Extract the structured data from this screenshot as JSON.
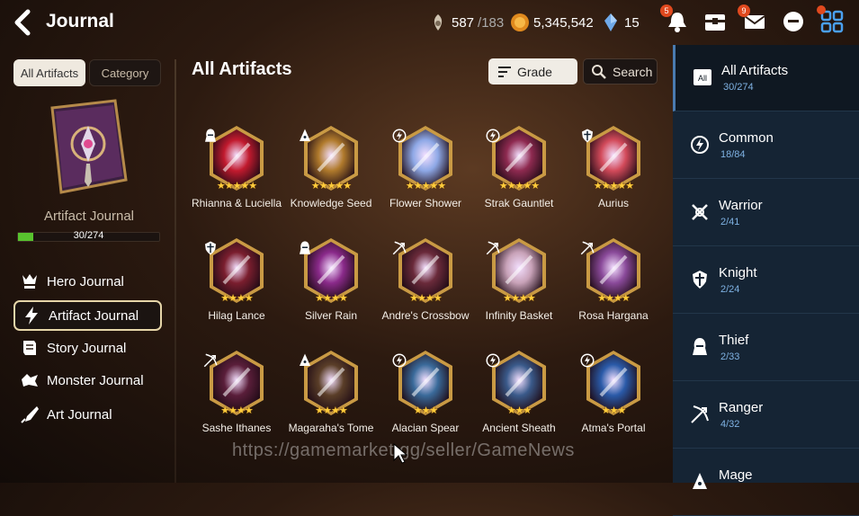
{
  "header": {
    "title": "Journal",
    "stamina": {
      "current": "587",
      "max": "/183"
    },
    "gold": "5,345,542",
    "crystal": "15",
    "badges": {
      "bell": "5",
      "mail": "9"
    }
  },
  "left_panel": {
    "tabs": [
      "All Artifacts",
      "Category"
    ],
    "book_label": "Artifact Journal",
    "progress_text": "30/274",
    "progress_fraction": 0.11,
    "menu": [
      {
        "label": "Hero Journal",
        "icon": "hero-icon"
      },
      {
        "label": "Artifact Journal",
        "icon": "lightning-icon"
      },
      {
        "label": "Story Journal",
        "icon": "story-icon"
      },
      {
        "label": "Monster Journal",
        "icon": "monster-icon"
      },
      {
        "label": "Art Journal",
        "icon": "art-icon"
      }
    ]
  },
  "main": {
    "title": "All Artifacts",
    "grade_label": "Grade",
    "search_label": "Search",
    "artifacts": [
      {
        "name": "Rhianna & Luciella",
        "stars": "★★★★★",
        "class": "thief",
        "color": "#c11a2e"
      },
      {
        "name": "Knowledge Seed",
        "stars": "★★★★★",
        "class": "mage",
        "color": "#b07a2c"
      },
      {
        "name": "Flower Shower",
        "stars": "★★★★★",
        "class": "common",
        "color": "#8ea8e6"
      },
      {
        "name": "Strak Gauntlet",
        "stars": "★★★★★",
        "class": "common",
        "color": "#8e2a50"
      },
      {
        "name": "Aurius",
        "stars": "★★★★★",
        "class": "knight",
        "color": "#d24a5a"
      },
      {
        "name": "Hilag Lance",
        "stars": "★★★★",
        "class": "knight",
        "color": "#7a1e2e"
      },
      {
        "name": "Silver Rain",
        "stars": "★★★★",
        "class": "thief",
        "color": "#8a2a8a"
      },
      {
        "name": "Andre's Crossbow",
        "stars": "★★★★",
        "class": "ranger",
        "color": "#6a2a3a"
      },
      {
        "name": "Infinity Basket",
        "stars": "★★★★",
        "class": "ranger",
        "color": "#c8a2b8"
      },
      {
        "name": "Rosa Hargana",
        "stars": "★★★★",
        "class": "ranger",
        "color": "#8a4a9a"
      },
      {
        "name": "Sashe Ithanes",
        "stars": "★★★★",
        "class": "ranger",
        "color": "#5a1e3a"
      },
      {
        "name": "Magaraha's Tome",
        "stars": "★★★★",
        "class": "mage",
        "color": "#5a3e28"
      },
      {
        "name": "Alacian Spear",
        "stars": "★★★",
        "class": "common",
        "color": "#3a6a9a"
      },
      {
        "name": "Ancient Sheath",
        "stars": "★★★",
        "class": "common",
        "color": "#3a5a8a"
      },
      {
        "name": "Atma's Portal",
        "stars": "★★★",
        "class": "common",
        "color": "#2a5aa8"
      }
    ]
  },
  "right_panel": {
    "categories": [
      {
        "label": "All Artifacts",
        "count": "30/274",
        "icon": "all-icon"
      },
      {
        "label": "Common",
        "count": "18/84",
        "icon": "common-icon"
      },
      {
        "label": "Warrior",
        "count": "2/41",
        "icon": "warrior-icon"
      },
      {
        "label": "Knight",
        "count": "2/24",
        "icon": "knight-icon"
      },
      {
        "label": "Thief",
        "count": "2/33",
        "icon": "thief-icon"
      },
      {
        "label": "Ranger",
        "count": "4/32",
        "icon": "ranger-icon"
      },
      {
        "label": "Mage",
        "count": "",
        "icon": "mage-icon"
      }
    ]
  },
  "watermark": "https://gamemarket.gg/seller/GameNews"
}
